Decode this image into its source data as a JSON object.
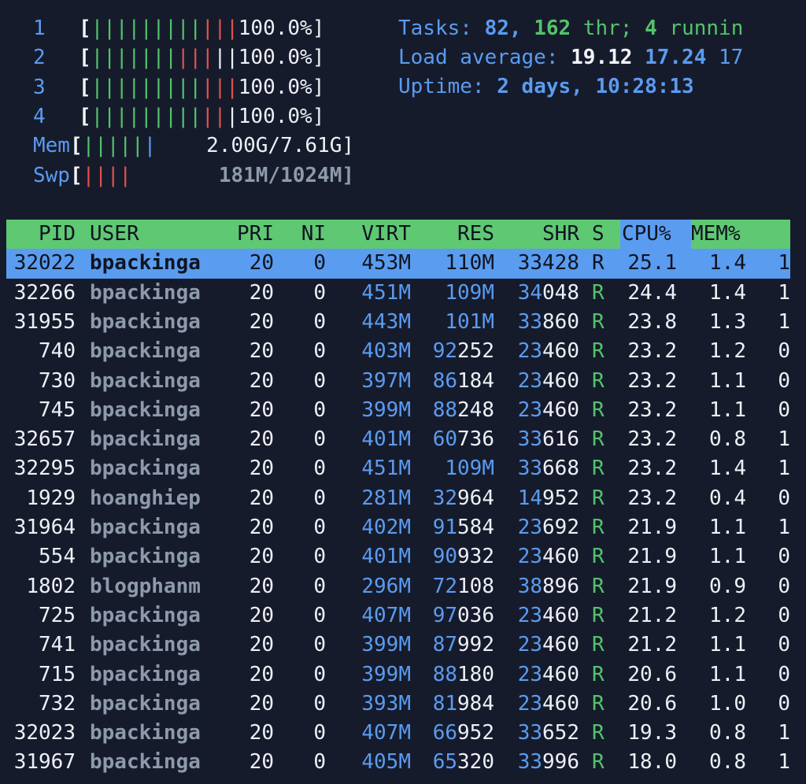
{
  "meters": {
    "cpus": [
      {
        "label": "1",
        "value": "100.0%]",
        "bars": "GGGGGGGGGRRR"
      },
      {
        "label": "2",
        "value": "100.0%]",
        "bars": "GGGGGGGRRRWW"
      },
      {
        "label": "3",
        "value": "100.0%]",
        "bars": "GGGGGGGGGRRR"
      },
      {
        "label": "4",
        "value": "100.0%]",
        "bars": "GGGGGGGGGRRW"
      }
    ],
    "mem": {
      "label": "Mem",
      "value": "2.00G/7.61G]",
      "bars": "GGGGGB"
    },
    "swp": {
      "label": "Swp",
      "value": "181M/1024M]",
      "bars": "RRRR"
    }
  },
  "summary": {
    "tasks_label": "Tasks:",
    "tasks": "82,",
    "threads": "162",
    "threads_label": "thr;",
    "running": "4",
    "running_label": "runnin",
    "load_label": "Load average:",
    "load1": "19.12",
    "load5": "17.24",
    "load15": "17",
    "uptime_label": "Uptime:",
    "uptime": "2 days, 10:28:13"
  },
  "columns": {
    "pid": "PID",
    "user": "USER",
    "pri": "PRI",
    "ni": "NI",
    "virt": "VIRT",
    "res": "RES",
    "shr": "SHR",
    "s": "S",
    "cpu": "CPU%",
    "mem": "MEM%"
  },
  "processes": [
    {
      "pid": "32022",
      "user": "bpackinga",
      "pri": "20",
      "ni": "0",
      "virt": "453M",
      "res_hi": "",
      "res_lo": "110M",
      "shr_hi": "33",
      "shr_lo": "428",
      "s": "R",
      "cpu": "25.1",
      "mem": "1.4",
      "cpuidx": "1",
      "selected": true
    },
    {
      "pid": "32266",
      "user": "bpackinga",
      "pri": "20",
      "ni": "0",
      "virt": "451M",
      "res_hi": "",
      "res_lo": "109M",
      "shr_hi": "34",
      "shr_lo": "048",
      "s": "R",
      "cpu": "24.4",
      "mem": "1.4",
      "cpuidx": "1"
    },
    {
      "pid": "31955",
      "user": "bpackinga",
      "pri": "20",
      "ni": "0",
      "virt": "443M",
      "res_hi": "",
      "res_lo": "101M",
      "shr_hi": "33",
      "shr_lo": "860",
      "s": "R",
      "cpu": "23.8",
      "mem": "1.3",
      "cpuidx": "1"
    },
    {
      "pid": "740",
      "user": "bpackinga",
      "pri": "20",
      "ni": "0",
      "virt": "403M",
      "res_hi": "92",
      "res_lo": "252",
      "shr_hi": "23",
      "shr_lo": "460",
      "s": "R",
      "cpu": "23.2",
      "mem": "1.2",
      "cpuidx": "0"
    },
    {
      "pid": "730",
      "user": "bpackinga",
      "pri": "20",
      "ni": "0",
      "virt": "397M",
      "res_hi": "86",
      "res_lo": "184",
      "shr_hi": "23",
      "shr_lo": "460",
      "s": "R",
      "cpu": "23.2",
      "mem": "1.1",
      "cpuidx": "0"
    },
    {
      "pid": "745",
      "user": "bpackinga",
      "pri": "20",
      "ni": "0",
      "virt": "399M",
      "res_hi": "88",
      "res_lo": "248",
      "shr_hi": "23",
      "shr_lo": "460",
      "s": "R",
      "cpu": "23.2",
      "mem": "1.1",
      "cpuidx": "0"
    },
    {
      "pid": "32657",
      "user": "bpackinga",
      "pri": "20",
      "ni": "0",
      "virt": "401M",
      "res_hi": "60",
      "res_lo": "736",
      "shr_hi": "33",
      "shr_lo": "616",
      "s": "R",
      "cpu": "23.2",
      "mem": "0.8",
      "cpuidx": "1"
    },
    {
      "pid": "32295",
      "user": "bpackinga",
      "pri": "20",
      "ni": "0",
      "virt": "451M",
      "res_hi": "",
      "res_lo": "109M",
      "shr_hi": "33",
      "shr_lo": "668",
      "s": "R",
      "cpu": "23.2",
      "mem": "1.4",
      "cpuidx": "1"
    },
    {
      "pid": "1929",
      "user": "hoanghiep",
      "pri": "20",
      "ni": "0",
      "virt": "281M",
      "res_hi": "32",
      "res_lo": "964",
      "shr_hi": "14",
      "shr_lo": "952",
      "s": "R",
      "cpu": "23.2",
      "mem": "0.4",
      "cpuidx": "0"
    },
    {
      "pid": "31964",
      "user": "bpackinga",
      "pri": "20",
      "ni": "0",
      "virt": "402M",
      "res_hi": "91",
      "res_lo": "584",
      "shr_hi": "23",
      "shr_lo": "692",
      "s": "R",
      "cpu": "21.9",
      "mem": "1.1",
      "cpuidx": "1"
    },
    {
      "pid": "554",
      "user": "bpackinga",
      "pri": "20",
      "ni": "0",
      "virt": "401M",
      "res_hi": "90",
      "res_lo": "932",
      "shr_hi": "23",
      "shr_lo": "460",
      "s": "R",
      "cpu": "21.9",
      "mem": "1.1",
      "cpuidx": "0"
    },
    {
      "pid": "1802",
      "user": "blogphanm",
      "pri": "20",
      "ni": "0",
      "virt": "296M",
      "res_hi": "72",
      "res_lo": "108",
      "shr_hi": "38",
      "shr_lo": "896",
      "s": "R",
      "cpu": "21.9",
      "mem": "0.9",
      "cpuidx": "0"
    },
    {
      "pid": "725",
      "user": "bpackinga",
      "pri": "20",
      "ni": "0",
      "virt": "407M",
      "res_hi": "97",
      "res_lo": "036",
      "shr_hi": "23",
      "shr_lo": "460",
      "s": "R",
      "cpu": "21.2",
      "mem": "1.2",
      "cpuidx": "0"
    },
    {
      "pid": "741",
      "user": "bpackinga",
      "pri": "20",
      "ni": "0",
      "virt": "399M",
      "res_hi": "87",
      "res_lo": "992",
      "shr_hi": "23",
      "shr_lo": "460",
      "s": "R",
      "cpu": "21.2",
      "mem": "1.1",
      "cpuidx": "0"
    },
    {
      "pid": "715",
      "user": "bpackinga",
      "pri": "20",
      "ni": "0",
      "virt": "399M",
      "res_hi": "88",
      "res_lo": "180",
      "shr_hi": "23",
      "shr_lo": "460",
      "s": "R",
      "cpu": "20.6",
      "mem": "1.1",
      "cpuidx": "0"
    },
    {
      "pid": "732",
      "user": "bpackinga",
      "pri": "20",
      "ni": "0",
      "virt": "393M",
      "res_hi": "81",
      "res_lo": "984",
      "shr_hi": "23",
      "shr_lo": "460",
      "s": "R",
      "cpu": "20.6",
      "mem": "1.0",
      "cpuidx": "0"
    },
    {
      "pid": "32023",
      "user": "bpackinga",
      "pri": "20",
      "ni": "0",
      "virt": "407M",
      "res_hi": "66",
      "res_lo": "952",
      "shr_hi": "33",
      "shr_lo": "652",
      "s": "R",
      "cpu": "19.3",
      "mem": "0.8",
      "cpuidx": "1"
    },
    {
      "pid": "31967",
      "user": "bpackinga",
      "pri": "20",
      "ni": "0",
      "virt": "405M",
      "res_hi": "65",
      "res_lo": "320",
      "shr_hi": "33",
      "shr_lo": "996",
      "s": "R",
      "cpu": "18.0",
      "mem": "0.8",
      "cpuidx": "1"
    }
  ],
  "colors": {
    "background": "#161b2c",
    "header_bg": "#5fc873",
    "sort_column_bg": "#5a9cf0",
    "selected_row_bg": "#5a9cf0",
    "blue": "#5a9cf0",
    "green": "#52c46a",
    "red": "#e0544a",
    "gray": "#8e9aaa"
  }
}
